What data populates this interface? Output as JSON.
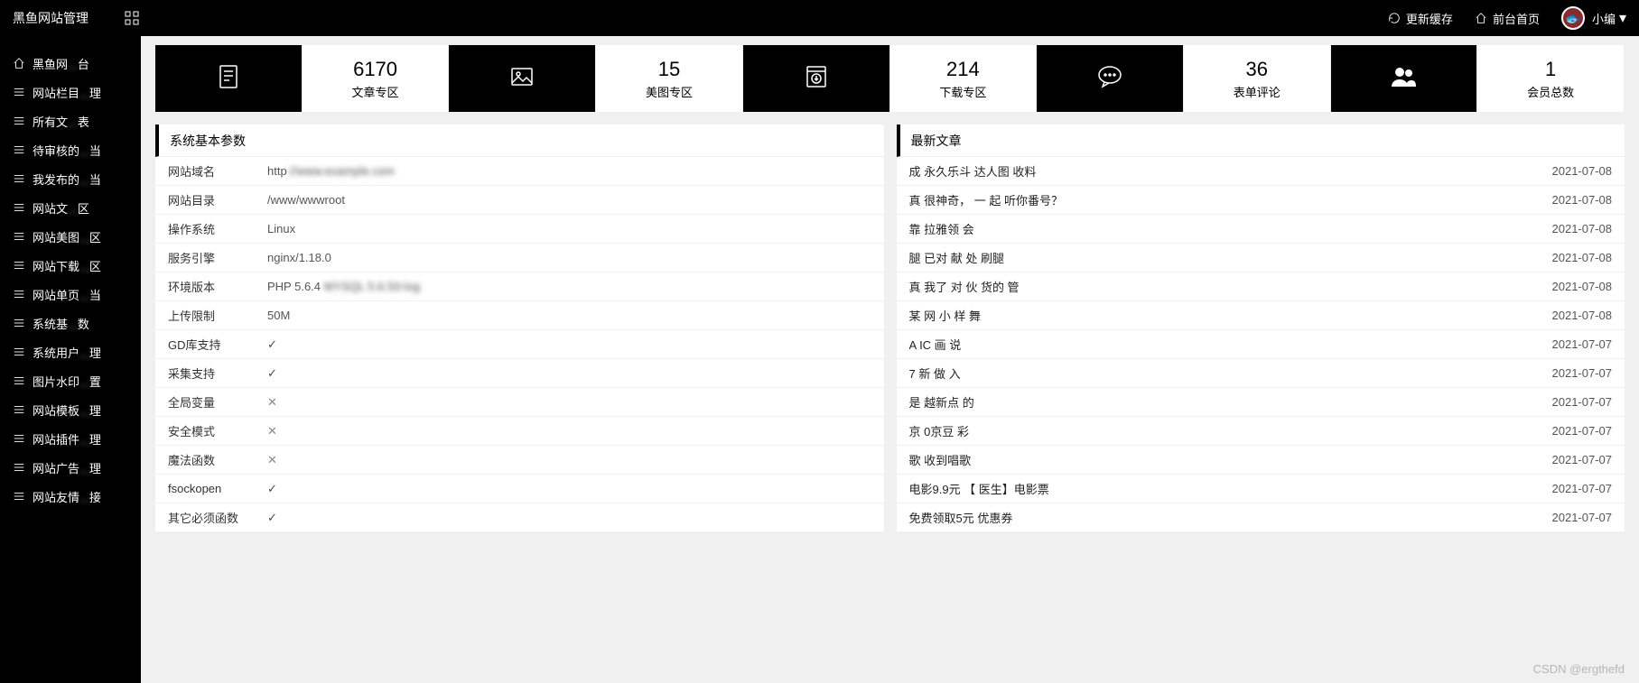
{
  "header": {
    "brand": "黑鱼网站管理",
    "refresh_cache": "更新缓存",
    "front_home": "前台首页",
    "username": "小编"
  },
  "sidebar": {
    "items": [
      {
        "icon": "home",
        "label": "黑鱼网",
        "blur": "台"
      },
      {
        "icon": "list",
        "label": "网站栏目",
        "blur": "理"
      },
      {
        "icon": "list",
        "label": "所有文",
        "blur": "表"
      },
      {
        "icon": "list",
        "label": "待审核的",
        "blur": "当"
      },
      {
        "icon": "list",
        "label": "我发布的",
        "blur": "当"
      },
      {
        "icon": "list",
        "label": "网站文",
        "blur": "区"
      },
      {
        "icon": "list",
        "label": "网站美图",
        "blur": "区"
      },
      {
        "icon": "list",
        "label": "网站下载",
        "blur": "区"
      },
      {
        "icon": "list",
        "label": "网站单页",
        "blur": "当"
      },
      {
        "icon": "list",
        "label": "系统基",
        "blur": "数"
      },
      {
        "icon": "list",
        "label": "系统用户",
        "blur": "理"
      },
      {
        "icon": "list",
        "label": "图片水印",
        "blur": "置"
      },
      {
        "icon": "list",
        "label": "网站模板",
        "blur": "理"
      },
      {
        "icon": "list",
        "label": "网站插件",
        "blur": "理"
      },
      {
        "icon": "list",
        "label": "网站广告",
        "blur": "理"
      },
      {
        "icon": "list",
        "label": "网站友情",
        "blur": "接"
      }
    ]
  },
  "stats": [
    {
      "type": "icon",
      "icon": "doc"
    },
    {
      "type": "num",
      "num": "6170",
      "label": "文章专区"
    },
    {
      "type": "icon",
      "icon": "image"
    },
    {
      "type": "num",
      "num": "15",
      "label": "美图专区"
    },
    {
      "type": "icon",
      "icon": "download"
    },
    {
      "type": "num",
      "num": "214",
      "label": "下载专区"
    },
    {
      "type": "icon",
      "icon": "comment"
    },
    {
      "type": "num",
      "num": "36",
      "label": "表单评论"
    },
    {
      "type": "icon",
      "icon": "users"
    },
    {
      "type": "num",
      "num": "1",
      "label": "会员总数"
    }
  ],
  "params": {
    "title": "系统基本参数",
    "rows": [
      {
        "label": "网站域名",
        "value": "http",
        "blur": "://www.example.com"
      },
      {
        "label": "网站目录",
        "value": "/www/wwwroot",
        "blur": ""
      },
      {
        "label": "操作系统",
        "value": "Linux",
        "blur": ""
      },
      {
        "label": "服务引擎",
        "value": "nginx/1.18.0",
        "blur": ""
      },
      {
        "label": "环境版本",
        "value": "PHP 5.6.4",
        "blur": "    MYSQL 5.6.50-log"
      },
      {
        "label": "上传限制",
        "value": "50M",
        "blur": ""
      },
      {
        "label": "GD库支持",
        "value": "check",
        "blur": ""
      },
      {
        "label": "采集支持",
        "value": "check",
        "blur": ""
      },
      {
        "label": "全局变量",
        "value": "cross",
        "blur": ""
      },
      {
        "label": "安全模式",
        "value": "cross",
        "blur": ""
      },
      {
        "label": "魔法函数",
        "value": "cross",
        "blur": ""
      },
      {
        "label": "fsockopen",
        "value": "check",
        "blur": ""
      },
      {
        "label": "其它必须函数",
        "value": "check",
        "blur": ""
      }
    ]
  },
  "articles": {
    "title": "最新文章",
    "rows": [
      {
        "title": "成  永久乐斗 达人图  收料",
        "date": "2021-07-08"
      },
      {
        "title": "真  很神奇，  一  起  听你番号？",
        "date": "2021-07-08"
      },
      {
        "title": "靠  拉雅领  会  ",
        "date": "2021-07-08"
      },
      {
        "title": "腿  已对  献  处  刷腿",
        "date": "2021-07-08"
      },
      {
        "title": "真  我了  对  伙  货的  管",
        "date": "2021-07-08"
      },
      {
        "title": "某  网  小  样  舞",
        "date": "2021-07-08"
      },
      {
        "title": "A  IC  画  说  ",
        "date": "2021-07-07"
      },
      {
        "title": "7  新  做  入",
        "date": "2021-07-07"
      },
      {
        "title": "是  越新点  的  ",
        "date": "2021-07-07"
      },
      {
        "title": "京  0京豆  彩",
        "date": "2021-07-07"
      },
      {
        "title": "歌  收到唱歌  ",
        "date": "2021-07-07"
      },
      {
        "title": "  电影9.9元  【  医生】电影票",
        "date": "2021-07-07"
      },
      {
        "title": "免费领取5元  优惠券",
        "date": "2021-07-07"
      }
    ]
  },
  "watermark": "CSDN @ergthefd"
}
